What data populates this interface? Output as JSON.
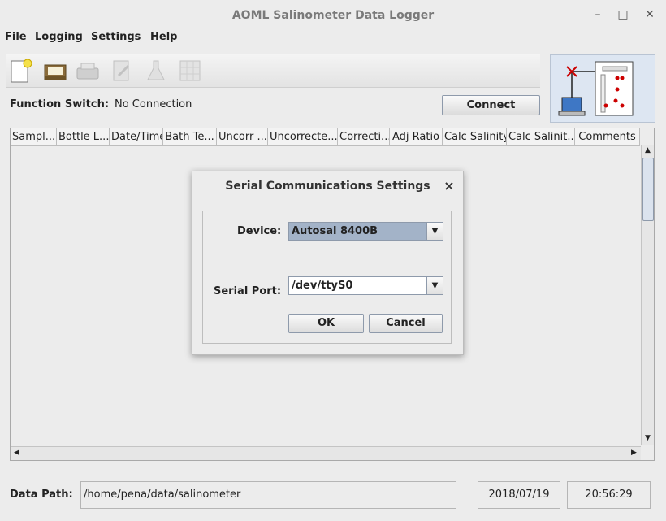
{
  "window": {
    "title": "AOML Salinometer Data Logger",
    "minimize_glyph": "–",
    "maximize_glyph": "□",
    "close_glyph": "✕"
  },
  "menu": [
    "File",
    "Logging",
    "Settings",
    "Help"
  ],
  "toolbar": {
    "icons": [
      "new-file-icon",
      "open-folder-icon",
      "print-icon",
      "edit-document-icon",
      "flask-icon",
      "spreadsheet-icon"
    ]
  },
  "function_switch": {
    "label": "Function Switch:",
    "value": "No Connection",
    "connect_label": "Connect"
  },
  "table": {
    "columns": [
      "Sampl...",
      "Bottle L...",
      "Date/Time",
      "Bath Te...",
      "Uncorr ...",
      "Uncorrecte...",
      "Correcti...",
      "Adj Ratio",
      "Calc Salinity",
      "Calc Salinit...",
      "Comments"
    ],
    "rows": []
  },
  "dialog": {
    "title": "Serial Communications Settings",
    "close_glyph": "×",
    "device_label": "Device:",
    "device_value": "Autosal 8400B",
    "port_label": "Serial Port:",
    "port_value": "/dev/ttyS0",
    "ok_label": "OK",
    "cancel_label": "Cancel"
  },
  "status": {
    "data_path_label": "Data Path:",
    "data_path_value": "/home/pena/data/salinometer",
    "date": "2018/07/19",
    "time": "20:56:29"
  },
  "colors": {
    "accent": "#a3b3c8",
    "table_background": "#ececec",
    "disconnect_mark": "#cc0000"
  }
}
